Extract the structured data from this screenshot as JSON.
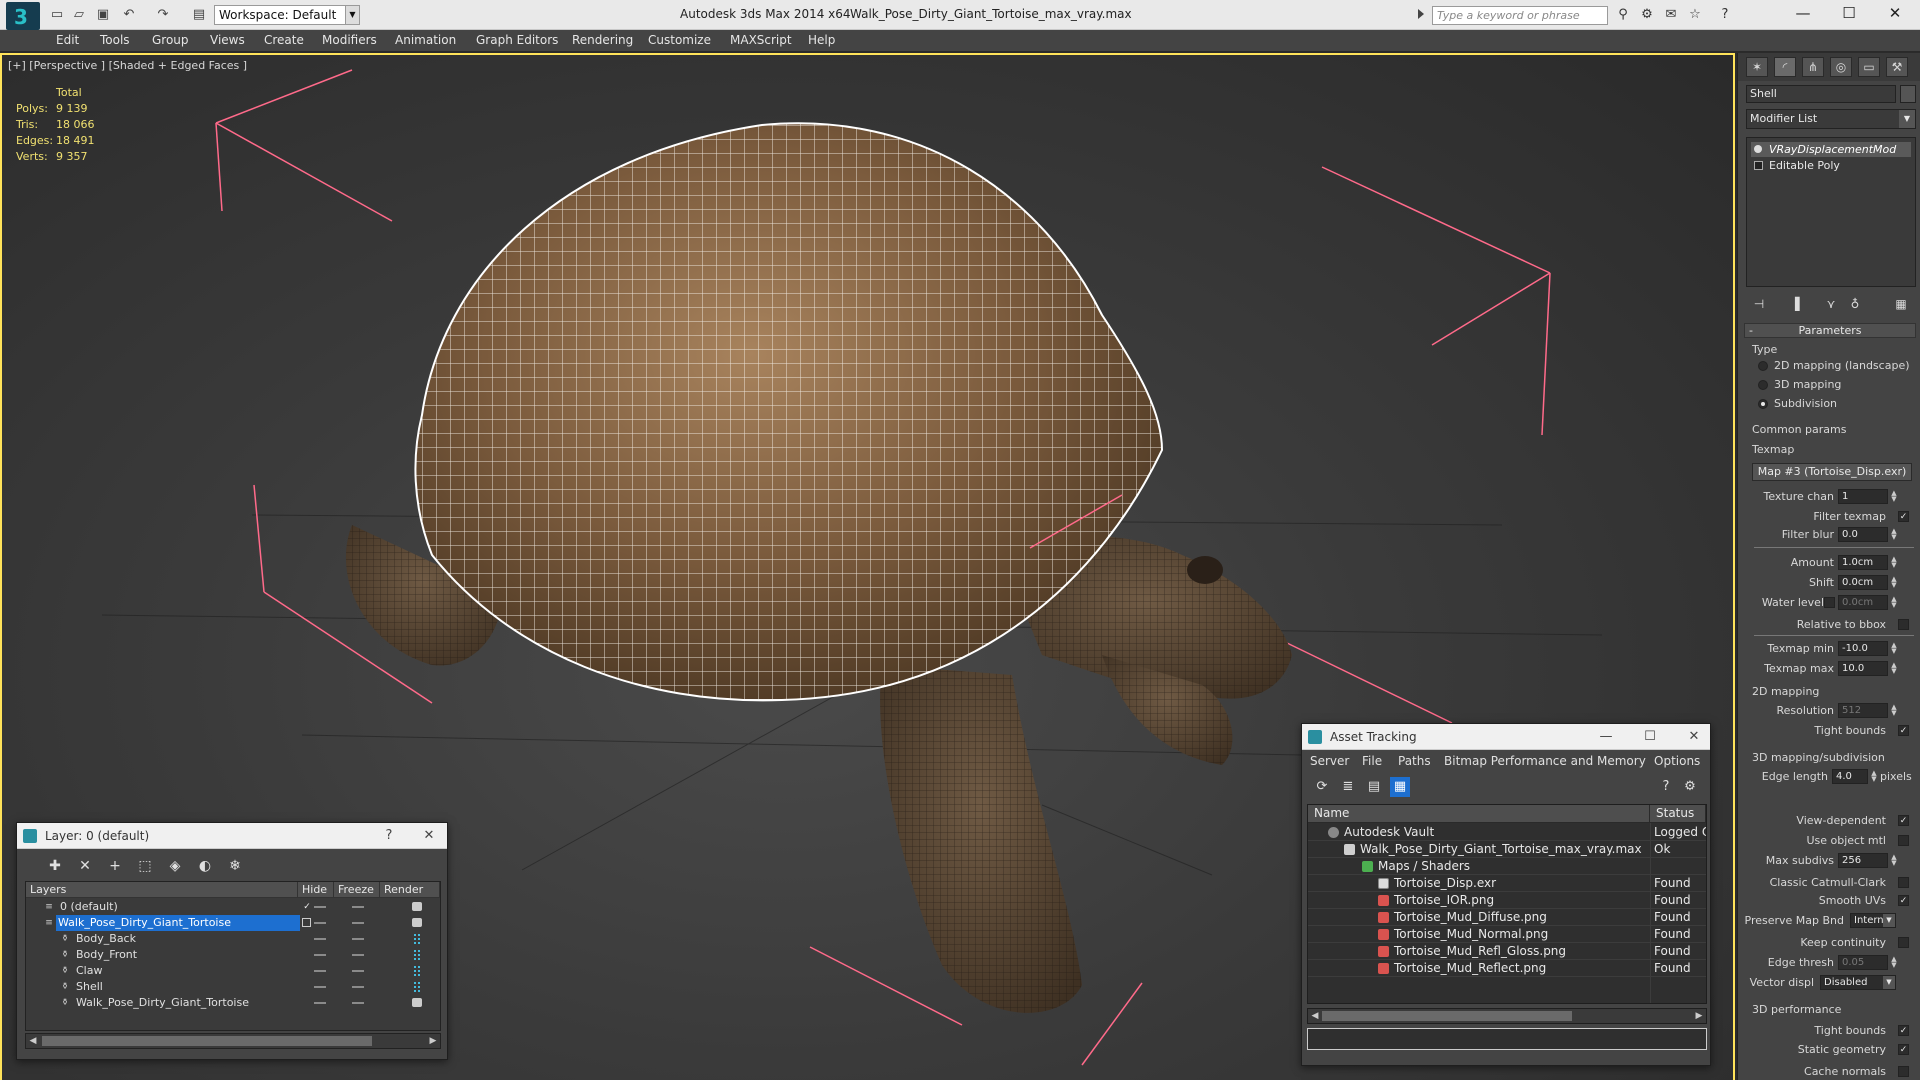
{
  "titlebar": {
    "workspace": "Workspace: Default",
    "app_title": "Autodesk 3ds Max  2014 x64",
    "file_title": "Walk_Pose_Dirty_Giant_Tortoise_max_vray.max",
    "search_placeholder": "Type a keyword or phrase"
  },
  "menu": [
    "Edit",
    "Tools",
    "Group",
    "Views",
    "Create",
    "Modifiers",
    "Animation",
    "Graph Editors",
    "Rendering",
    "Customize",
    "MAXScript",
    "Help"
  ],
  "viewport": {
    "label": "[+] [Perspective ] [Shaded + Edged Faces ]",
    "stats_header": "Total",
    "stats": [
      {
        "label": "Polys:",
        "value": "9 139"
      },
      {
        "label": "Tris:",
        "value": "18 066"
      },
      {
        "label": "Edges:",
        "value": "18 491"
      },
      {
        "label": "Verts:",
        "value": "9 357"
      }
    ]
  },
  "command_panel": {
    "object_name": "Shell",
    "modifier_list": "Modifier List",
    "stack": [
      "VRayDisplacementMod",
      "Editable Poly"
    ],
    "parameters_title": "Parameters",
    "type_label": "Type",
    "type_options": [
      "2D mapping (landscape)",
      "3D mapping",
      "Subdivision"
    ],
    "common_params": "Common params",
    "texmap_label": "Texmap",
    "texmap_button": "Map #3 (Tortoise_Disp.exr)",
    "texture_chan": {
      "label": "Texture chan",
      "value": "1"
    },
    "filter_texmap": "Filter texmap",
    "filter_blur": {
      "label": "Filter blur",
      "value": "0.0"
    },
    "amount": {
      "label": "Amount",
      "value": "1.0cm"
    },
    "shift": {
      "label": "Shift",
      "value": "0.0cm"
    },
    "water_level": {
      "label": "Water level",
      "value": "0.0cm"
    },
    "relative_bbox": "Relative to bbox",
    "texmap_min": {
      "label": "Texmap min",
      "value": "-10.0"
    },
    "texmap_max": {
      "label": "Texmap max",
      "value": "10.0"
    },
    "mapping2d_title": "2D mapping",
    "resolution": {
      "label": "Resolution",
      "value": "512"
    },
    "tight_bounds": "Tight bounds",
    "mapping3d_title": "3D mapping/subdivision",
    "edge_length": {
      "label": "Edge length",
      "value": "4.0",
      "unit": "pixels"
    },
    "view_dependent": "View-dependent",
    "use_object_mtl": "Use object mtl",
    "max_subdivs": {
      "label": "Max subdivs",
      "value": "256"
    },
    "classic_catmull": "Classic Catmull-Clark",
    "smooth_uvs": "Smooth UVs",
    "preserve_map_bnd": {
      "label": "Preserve Map Bnd",
      "value": "Intern"
    },
    "keep_continuity": "Keep continuity",
    "edge_thresh": {
      "label": "Edge thresh",
      "value": "0.05"
    },
    "vector_displ": {
      "label": "Vector displ",
      "value": "Disabled"
    },
    "perf_title": "3D performance",
    "tight_bounds_2": "Tight bounds",
    "static_geometry": "Static geometry",
    "cache_normals": "Cache normals"
  },
  "layer_dialog": {
    "title": "Layer: 0 (default)",
    "help": "?",
    "columns": [
      "Layers",
      "Hide",
      "Freeze",
      "Render"
    ],
    "rows": [
      {
        "name": "0 (default)",
        "indent": 1
      },
      {
        "name": "Walk_Pose_Dirty_Giant_Tortoise",
        "indent": 1
      },
      {
        "name": "Body_Back",
        "indent": 2
      },
      {
        "name": "Body_Front",
        "indent": 2
      },
      {
        "name": "Claw",
        "indent": 2
      },
      {
        "name": "Shell",
        "indent": 2
      },
      {
        "name": "Walk_Pose_Dirty_Giant_Tortoise",
        "indent": 2
      }
    ]
  },
  "asset_dialog": {
    "title": "Asset Tracking",
    "menu": [
      "Server",
      "File",
      "Paths",
      "Bitmap Performance and Memory",
      "Options"
    ],
    "columns": [
      "Name",
      "Status"
    ],
    "rows": [
      {
        "name": "Autodesk Vault",
        "status": "Logged O",
        "indent": 0
      },
      {
        "name": "Walk_Pose_Dirty_Giant_Tortoise_max_vray.max",
        "status": "Ok",
        "indent": 1
      },
      {
        "name": "Maps / Shaders",
        "status": "",
        "indent": 2
      },
      {
        "name": "Tortoise_Disp.exr",
        "status": "Found",
        "indent": 3
      },
      {
        "name": "Tortoise_IOR.png",
        "status": "Found",
        "indent": 3
      },
      {
        "name": "Tortoise_Mud_Diffuse.png",
        "status": "Found",
        "indent": 3
      },
      {
        "name": "Tortoise_Mud_Normal.png",
        "status": "Found",
        "indent": 3
      },
      {
        "name": "Tortoise_Mud_Refl_Gloss.png",
        "status": "Found",
        "indent": 3
      },
      {
        "name": "Tortoise_Mud_Reflect.png",
        "status": "Found",
        "indent": 3
      }
    ]
  },
  "colors": {
    "viewport_border": "#ffe35a",
    "stats_text": "#f0e070",
    "selection": "#1d6fd0",
    "bbox_lines": "#ff6a8a"
  }
}
